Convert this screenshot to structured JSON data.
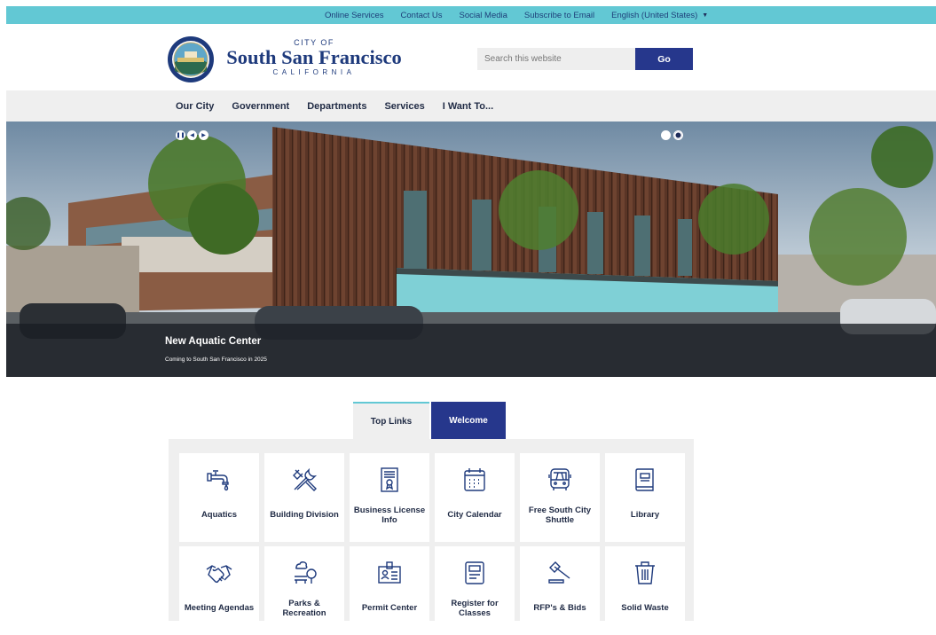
{
  "topbar": {
    "links": [
      "Online Services",
      "Contact Us",
      "Social Media",
      "Subscribe to Email"
    ],
    "language": "English (United States)"
  },
  "header": {
    "city_of": "CITY OF",
    "name": "South San Francisco",
    "state": "CALIFORNIA",
    "search_placeholder": "Search this website",
    "search_button": "Go"
  },
  "nav": {
    "items": [
      "Our City",
      "Government",
      "Departments",
      "Services",
      "I Want To..."
    ]
  },
  "hero": {
    "title": "New Aquatic Center",
    "subtitle": "Coming to South San Francisco in 2025",
    "slide_count": 2,
    "active_slide": 2
  },
  "tabs": {
    "top_links": "Top Links",
    "welcome": "Welcome"
  },
  "tiles": [
    {
      "label": "Aquatics",
      "icon": "faucet-icon"
    },
    {
      "label": "Building Division",
      "icon": "tools-icon"
    },
    {
      "label": "Business License Info",
      "icon": "license-icon"
    },
    {
      "label": "City Calendar",
      "icon": "calendar-icon"
    },
    {
      "label": "Free South City Shuttle",
      "icon": "bus-icon"
    },
    {
      "label": "Library",
      "icon": "book-icon"
    },
    {
      "label": "Meeting Agendas",
      "icon": "handshake-icon"
    },
    {
      "label": "Parks & Recreation",
      "icon": "park-icon"
    },
    {
      "label": "Permit Center",
      "icon": "permit-icon"
    },
    {
      "label": "Register for Classes",
      "icon": "register-icon"
    },
    {
      "label": "RFP's & Bids",
      "icon": "gavel-icon"
    },
    {
      "label": "Solid Waste",
      "icon": "trash-icon"
    }
  ],
  "colors": {
    "topbar": "#62c8d4",
    "brand_navy": "#26378c",
    "nav_bg": "#efefef",
    "icon_stroke": "#1e3a7c"
  }
}
